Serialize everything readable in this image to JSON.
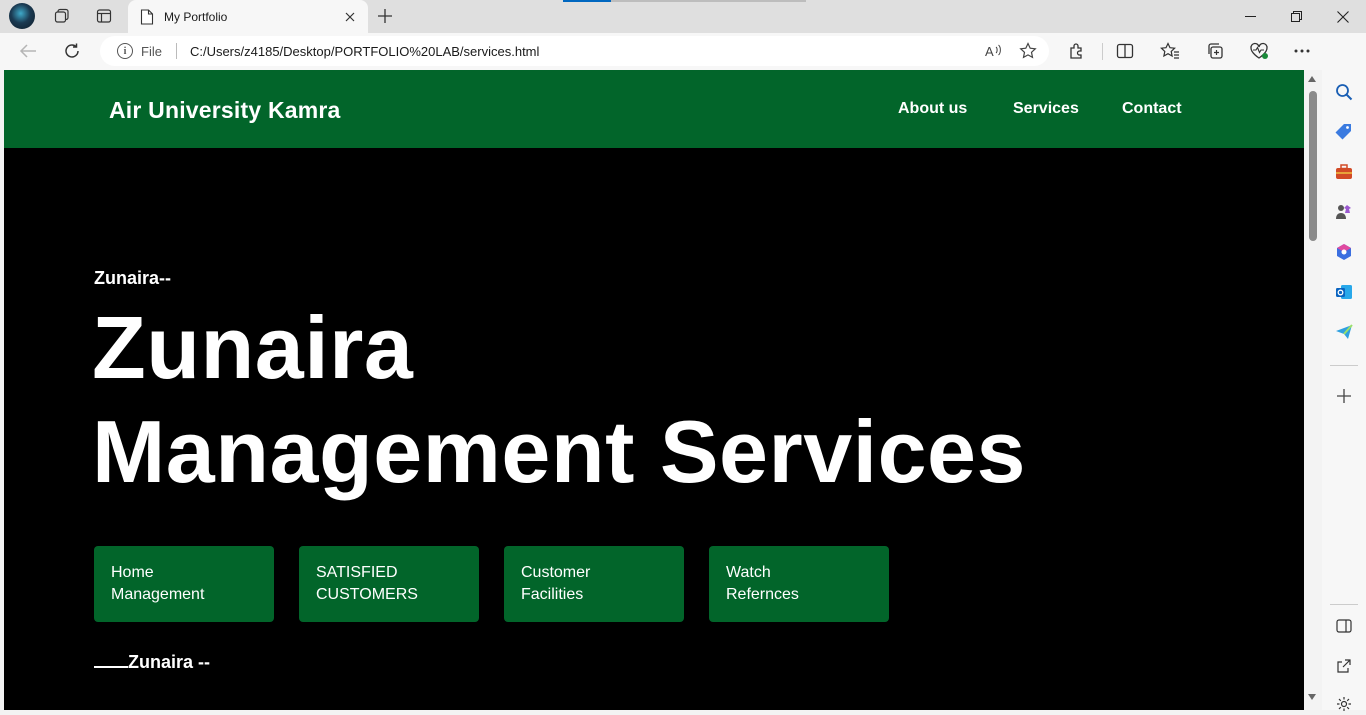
{
  "browser": {
    "tab": {
      "title": "My Portfolio"
    },
    "address": {
      "scheme_label": "File",
      "url": "C:/Users/z4185/Desktop/PORTFOLIO%20LAB/services.html"
    },
    "icons": {
      "profile": "profile-avatar",
      "workspaces": "workspaces-icon",
      "vertical_tabs": "vertical-tabs-icon",
      "back": "back-arrow-icon",
      "refresh": "refresh-icon",
      "read_aloud": "read-aloud-icon",
      "favorite": "star-icon",
      "extensions": "puzzle-icon",
      "split_screen": "split-screen-icon",
      "favorites": "favorites-icon",
      "collections": "collections-icon",
      "browser_essentials": "heart-pulse-icon",
      "more": "more-icon",
      "copilot": "copilot-icon"
    },
    "accent_color": "#0067c0"
  },
  "site": {
    "header": {
      "brand": "Air University Kamra",
      "nav": [
        "About us",
        "Services",
        "Contact"
      ],
      "bg_color": "#02652a"
    },
    "hero": {
      "eyebrow": "Zunaira--",
      "title_line1": "Zunaira",
      "title_line2": "Management Services"
    },
    "cards": [
      {
        "line1": "Home",
        "line2": "Management"
      },
      {
        "line1": "SATISFIED",
        "line2": "CUSTOMERS"
      },
      {
        "line1": "Customer",
        "line2": "Facilities"
      },
      {
        "line1": "Watch",
        "line2": "Refernces"
      }
    ],
    "footer": {
      "text": "Zunaira --"
    },
    "page_bg": "#000000"
  },
  "sidebar": {
    "items": [
      "search-icon",
      "shopping-tag-icon",
      "tools-icon",
      "games-icon",
      "microsoft365-icon",
      "outlook-icon",
      "drop-icon",
      "add-icon",
      "hide-sidebar-icon",
      "open-external-icon",
      "settings-icon"
    ]
  }
}
